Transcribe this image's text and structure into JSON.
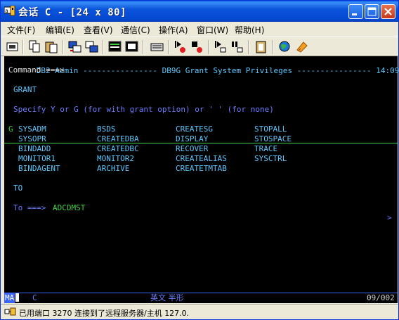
{
  "window": {
    "title": "会话 C - [24 x 80]"
  },
  "menu": [
    "文件(F)",
    "编辑(E)",
    "查看(V)",
    "通信(C)",
    "操作(A)",
    "窗口(W)",
    "帮助(H)"
  ],
  "toolbar": {
    "icons": [
      "print-screen-icon",
      "copy-icon",
      "paste-icon",
      "send-file-icon",
      "receive-file-icon",
      "display-setup-icon",
      "keyboard-icon",
      "keypad-icon",
      "macro-record-icon",
      "macro-stop-icon",
      "macro-play-icon",
      "macro-pause-icon",
      "clipboard-icon",
      "web-icon",
      "help-icon"
    ]
  },
  "terminal": {
    "header_left": "DB2 Admin",
    "header_dashes_left": "----------------",
    "header_title": "DB9G Grant System Privileges",
    "header_dashes_right": "----------------",
    "header_time": "14:09",
    "command_label": "Command ===>",
    "grant_label": "GRANT",
    "instructions": "Specify Y or G (for with grant option) or ' ' (for none)",
    "privileges": [
      {
        "flag": "G",
        "items": [
          "SYSADM",
          "BSDS",
          "CREATESG",
          "STOPALL"
        ]
      },
      {
        "flag": " ",
        "items": [
          "SYSOPR",
          "CREATEDBA",
          "DISPLAY",
          "STOSPACE"
        ]
      },
      {
        "flag": " ",
        "items": [
          "BINDADD",
          "CREATEDBC",
          "RECOVER",
          "TRACE"
        ]
      },
      {
        "flag": " ",
        "items": [
          "MONITOR1",
          "MONITOR2",
          "CREATEALIAS",
          "SYSCTRL"
        ]
      },
      {
        "flag": " ",
        "items": [
          "BINDAGENT",
          "ARCHIVE",
          "CREATETMTAB",
          ""
        ]
      }
    ],
    "to_label": "TO",
    "to_prompt": "To ===>",
    "to_value": "ADCDMST",
    "scroll_indicator": ">"
  },
  "oia": {
    "left": "MA",
    "session": "C",
    "input_mode": "英文 半形",
    "cursor_pos": "09/002"
  },
  "status": {
    "text": "已用端口 3270 连接到了远程服务器/主机 127.0."
  }
}
